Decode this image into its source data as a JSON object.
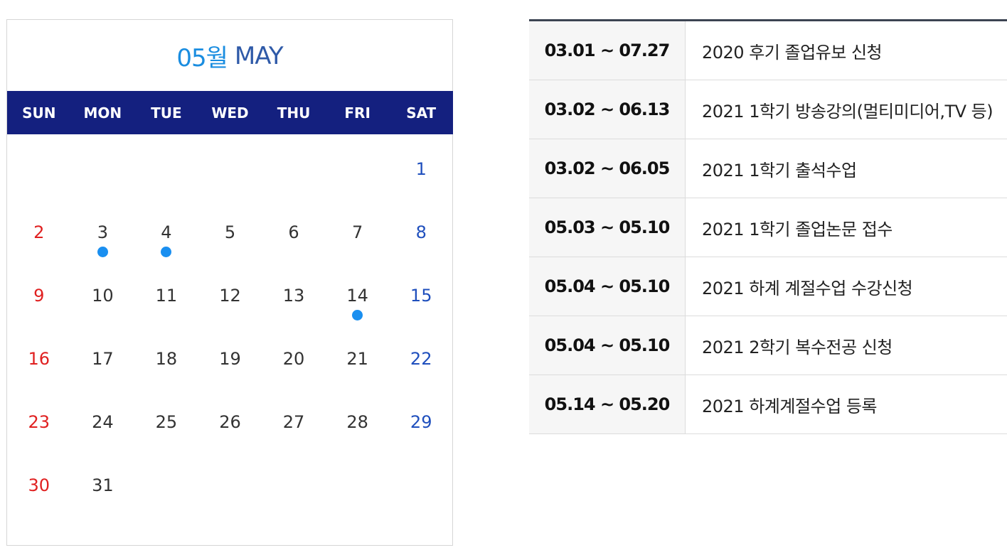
{
  "calendar": {
    "month_num": "05월",
    "month_eng": "MAY",
    "weekdays": [
      "SUN",
      "MON",
      "TUE",
      "WED",
      "THU",
      "FRI",
      "SAT"
    ],
    "days": [
      "1",
      "2",
      "3",
      "4",
      "5",
      "6",
      "7",
      "8",
      "9",
      "10",
      "11",
      "12",
      "13",
      "14",
      "15",
      "16",
      "17",
      "18",
      "19",
      "20",
      "21",
      "22",
      "23",
      "24",
      "25",
      "26",
      "27",
      "28",
      "29",
      "30",
      "31"
    ],
    "event_days": [
      "3",
      "4",
      "14"
    ],
    "colors": {
      "header_bg": "#14207f",
      "sunday": "#e02020",
      "saturday": "#1f4fbd",
      "event_dot": "#1a8ff0",
      "title_num": "#1a8de0",
      "title_eng": "#2f5aa8"
    }
  },
  "schedule": [
    {
      "date": "03.01 ~ 07.27",
      "title": "2020 후기 졸업유보 신청"
    },
    {
      "date": "03.02 ~ 06.13",
      "title": "2021 1학기 방송강의(멀티미디어,TV 등)"
    },
    {
      "date": "03.02 ~ 06.05",
      "title": "2021 1학기 출석수업"
    },
    {
      "date": "05.03 ~ 05.10",
      "title": "2021 1학기 졸업논문 접수"
    },
    {
      "date": "05.04 ~ 05.10",
      "title": "2021 하계 계절수업 수강신청"
    },
    {
      "date": "05.04 ~ 05.10",
      "title": "2021 2학기 복수전공 신청"
    },
    {
      "date": "05.14 ~ 05.20",
      "title": "2021 하계계절수업 등록"
    }
  ]
}
